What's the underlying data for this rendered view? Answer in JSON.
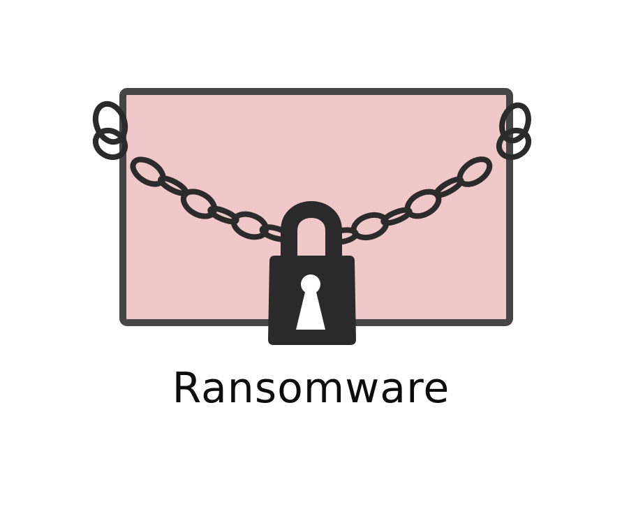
{
  "caption": "Ransomware",
  "colors": {
    "screen_fill": "#f0c8c9",
    "frame": "#454545",
    "chain": "#2b2b2b",
    "padlock": "#2a2a2a",
    "keyhole": "#ffffff",
    "text": "#0d0d0d",
    "background": "#ffffff"
  },
  "icons": {
    "screen": "screen-frame-icon",
    "chain": "chain-icon",
    "padlock": "padlock-icon"
  }
}
